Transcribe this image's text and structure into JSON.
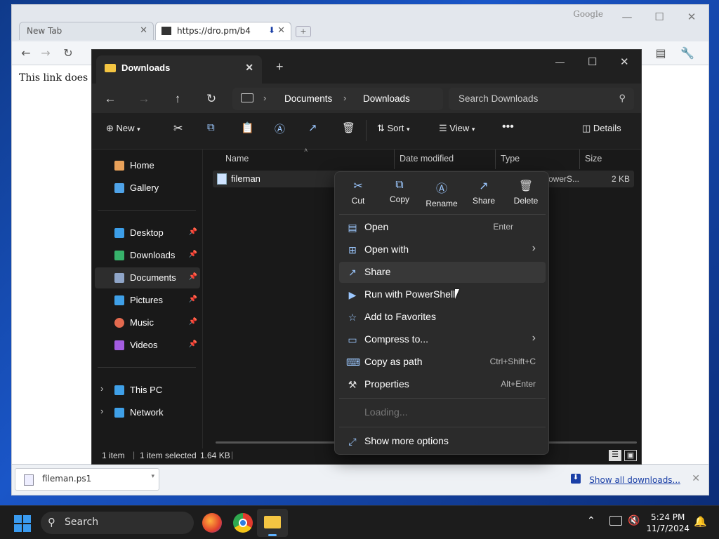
{
  "browser": {
    "tabs": [
      {
        "label": "New Tab"
      },
      {
        "label": "https://dro.pm/b4"
      }
    ],
    "google_label": "Google",
    "page_text": "This link does not",
    "download_file": "fileman.ps1",
    "show_all": "Show all downloads..."
  },
  "explorer": {
    "tab_title": "Downloads",
    "breadcrumb": [
      "Documents",
      "Downloads"
    ],
    "search_placeholder": "Search Downloads",
    "commands": {
      "new": "New",
      "sort": "Sort",
      "view": "View",
      "details": "Details"
    },
    "sidebar": [
      {
        "label": "Home",
        "icon": "home-icon",
        "color": "#e8a15a"
      },
      {
        "label": "Gallery",
        "icon": "gallery-icon",
        "color": "#4fa3e8"
      },
      {
        "label": "Desktop",
        "icon": "desktop-icon",
        "color": "#3c9ee8",
        "pin": true
      },
      {
        "label": "Downloads",
        "icon": "download-icon",
        "color": "#37b26b",
        "pin": true
      },
      {
        "label": "Documents",
        "icon": "documents-icon",
        "color": "#8fa5c8",
        "pin": true
      },
      {
        "label": "Pictures",
        "icon": "pictures-icon",
        "color": "#3fa0e8",
        "pin": true
      },
      {
        "label": "Music",
        "icon": "music-icon",
        "color": "#e36a4f",
        "pin": true
      },
      {
        "label": "Videos",
        "icon": "videos-icon",
        "color": "#a35ce0",
        "pin": true
      },
      {
        "label": "This PC",
        "icon": "computer-icon",
        "color": "#3fa0e8"
      },
      {
        "label": "Network",
        "icon": "network-icon",
        "color": "#3fa0e8"
      }
    ],
    "columns": [
      "Name",
      "Date modified",
      "Type",
      "Size"
    ],
    "file": {
      "name": "fileman",
      "type": "PowerS...",
      "size": "2 KB"
    },
    "status": {
      "count": "1 item",
      "selected": "1 item selected",
      "size": "1.64 KB"
    }
  },
  "context_menu": {
    "quick": [
      {
        "label": "Cut",
        "glyph": "✂"
      },
      {
        "label": "Copy",
        "glyph": "⧉"
      },
      {
        "label": "Rename",
        "glyph": "Ⓐ"
      },
      {
        "label": "Share",
        "glyph": "↗"
      },
      {
        "label": "Delete",
        "glyph": "🗑"
      }
    ],
    "items": [
      {
        "label": "Open",
        "shortcut": "Enter",
        "glyph": "▤"
      },
      {
        "label": "Open with",
        "arrow": "›",
        "glyph": "⊞"
      },
      {
        "label": "Share",
        "glyph": "↗"
      },
      {
        "label": "Run with PowerShell",
        "glyph": "▶"
      },
      {
        "label": "Add to Favorites",
        "glyph": "☆"
      },
      {
        "label": "Compress to...",
        "arrow": "›",
        "glyph": "▭"
      },
      {
        "label": "Copy as path",
        "shortcut": "Ctrl+Shift+C",
        "glyph": "⌨"
      },
      {
        "label": "Properties",
        "shortcut": "Alt+Enter",
        "glyph": "⚒"
      }
    ],
    "loading": "Loading...",
    "more": "Show more options"
  },
  "taskbar": {
    "search": "Search",
    "time": "5:24 PM",
    "date": "11/7/2024"
  }
}
